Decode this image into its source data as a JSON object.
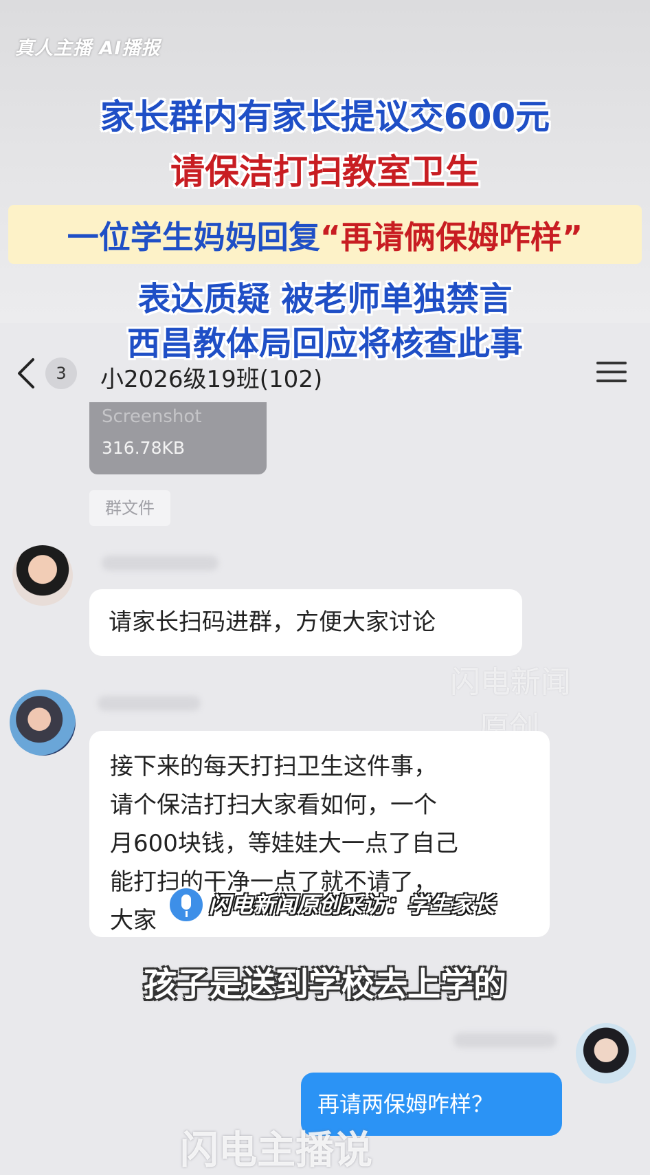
{
  "overlay": {
    "watermark_top": "真人主播 AI播报",
    "headline_1": "家长群内有家长提议交600元",
    "headline_2": "请保洁打扫教室卫生",
    "headline_3_prefix": "一位学生妈妈回复",
    "headline_3_quote": "“再请俩保姆咋样”",
    "headline_4": "表达质疑 被老师单独禁言",
    "headline_5": "西昌教体局回应将核查此事"
  },
  "chat": {
    "header": {
      "unread_count": "3",
      "group_title": "小2026级19班(102)"
    },
    "file": {
      "name": "Screenshot",
      "size": "316.78KB",
      "source": "群文件"
    },
    "messages": [
      {
        "text": "请家长扫码进群，方便大家讨论"
      },
      {
        "lines": [
          "接下来的每天打扫卫生这件事，",
          "请个保洁打扫大家看如何，一个",
          "月600块钱，等娃娃大一点了自己",
          "能打扫的干净一点了就不请了，",
          "大家"
        ]
      },
      {
        "text": "再请两保姆咋样？"
      }
    ]
  },
  "video": {
    "watermark_news": [
      "闪电新闻",
      "原创"
    ],
    "interview_tag": "闪电新闻原创采访：学生家长",
    "subtitle": "孩子是送到学校去上学的",
    "watermark_bottom": "闪电主播说"
  },
  "colors": {
    "headline_blue": "#1f4fc6",
    "headline_red": "#c81d22",
    "sent_bubble": "#2b93f5",
    "highlight_box": "#fdf2c8"
  }
}
